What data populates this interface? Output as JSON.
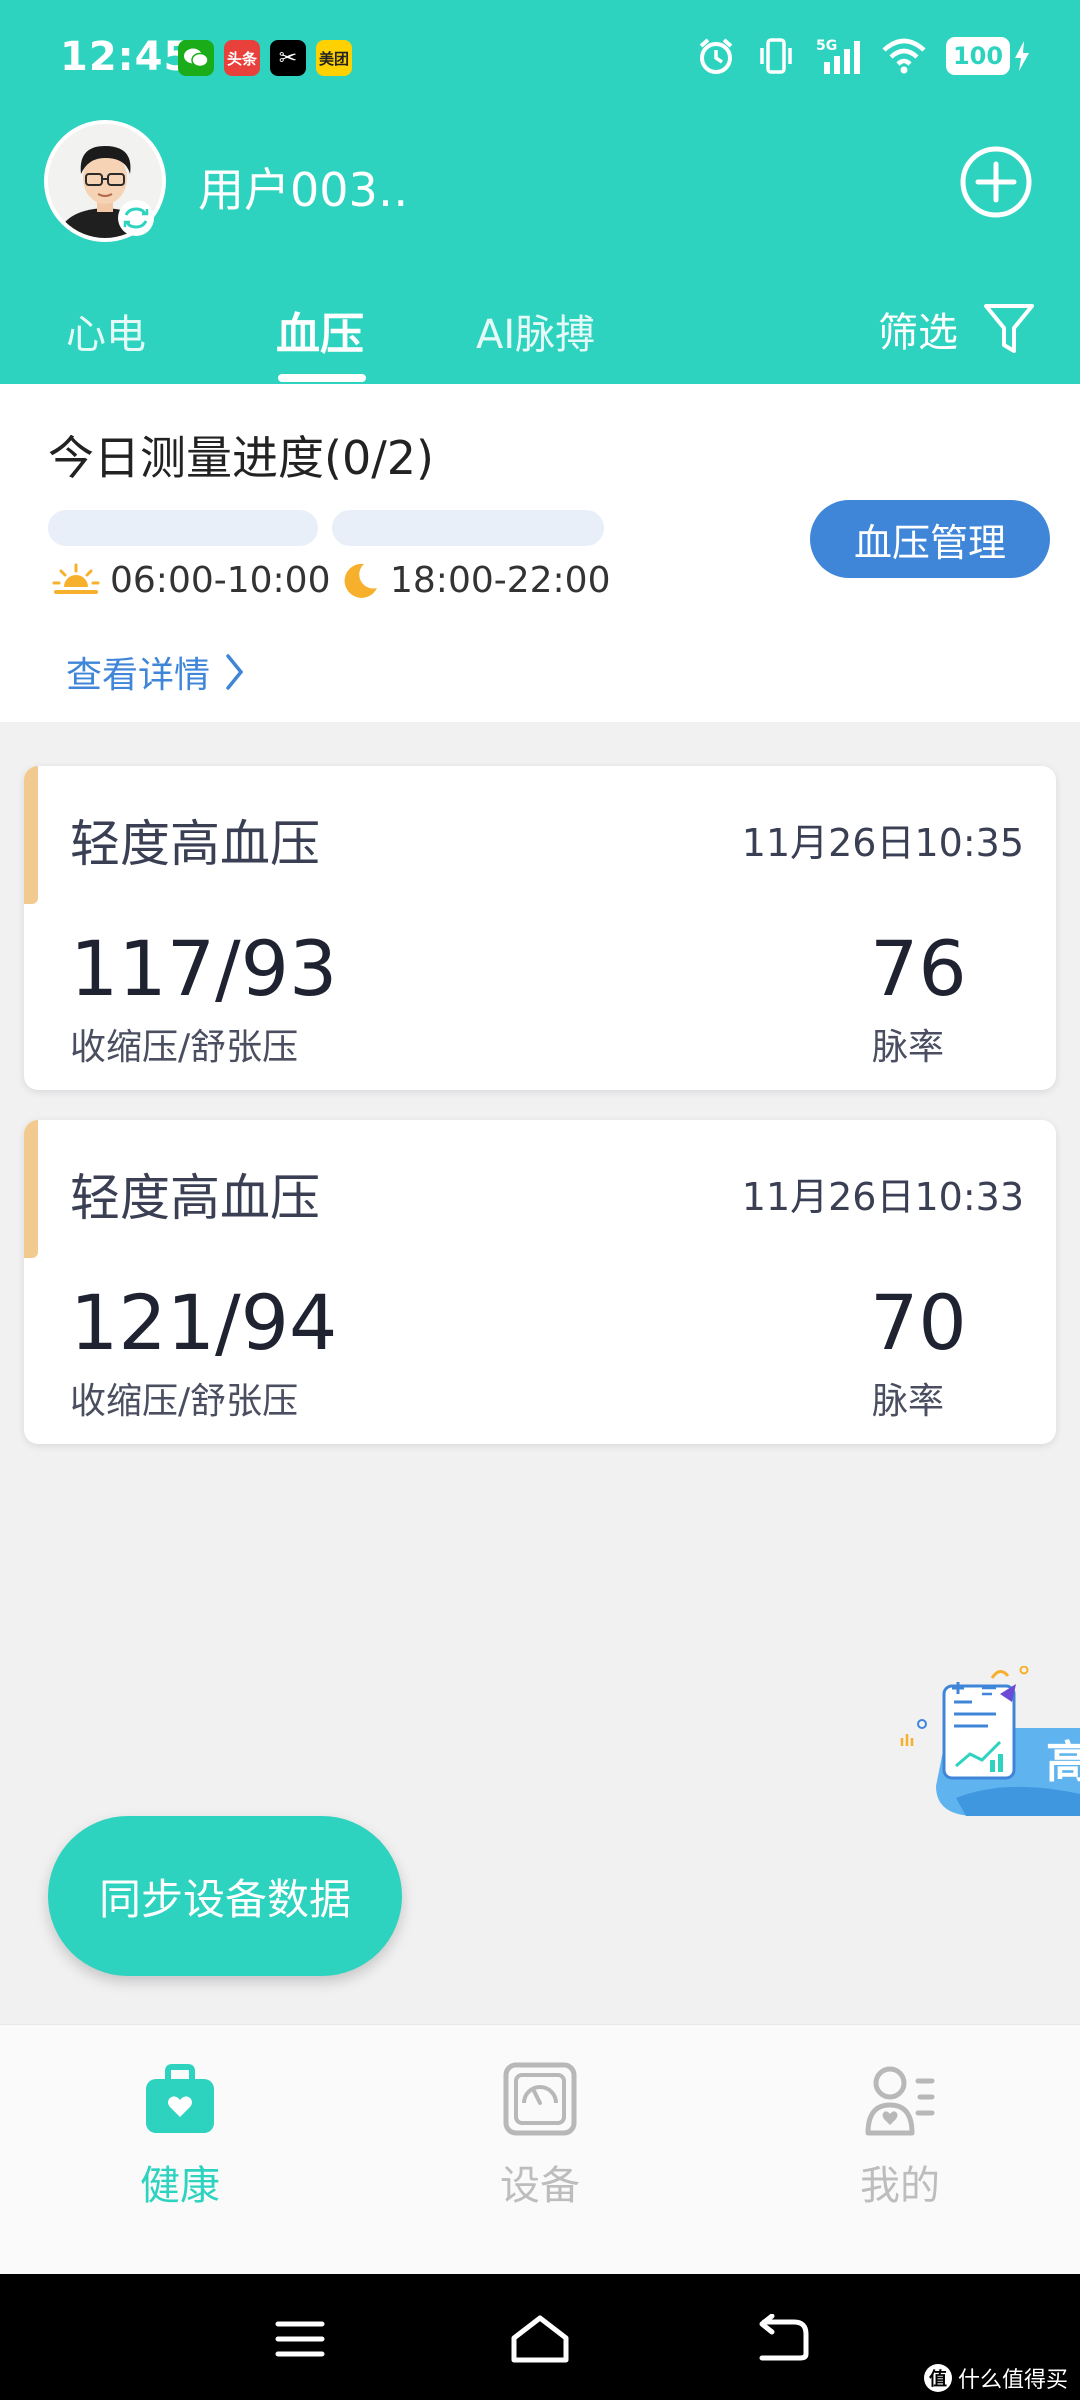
{
  "status_bar": {
    "time": "12:45",
    "apps": [
      {
        "name": "wechat-icon",
        "text": "",
        "bg": "#1aad19",
        "fg": "#ffffff"
      },
      {
        "name": "toutiao-icon",
        "text": "头条",
        "bg": "#e8413b",
        "fg": "#ffffff"
      },
      {
        "name": "capcut-icon",
        "text": "✂",
        "bg": "#000000",
        "fg": "#ffffff"
      },
      {
        "name": "meituan-icon",
        "text": "美团",
        "bg": "#ffd100",
        "fg": "#222222"
      }
    ],
    "network": "5G",
    "battery": "100"
  },
  "header": {
    "username": "用户003‥",
    "tabs": [
      {
        "label": "心电"
      },
      {
        "label": "血压"
      },
      {
        "label": "AI脉搏"
      }
    ],
    "filter_label": "筛选"
  },
  "progress": {
    "title": "今日测量进度(0/2)",
    "slot1": "06:00-10:00",
    "slot2": "18:00-22:00",
    "detail_link": "查看详情",
    "manage_button": "血压管理"
  },
  "records": [
    {
      "level": "轻度高血压",
      "datetime": "11月26日10:35",
      "bp": "117/93",
      "bp_label": "收缩压/舒张压",
      "pulse": "76",
      "pulse_label": "脉率"
    },
    {
      "level": "轻度高血压",
      "datetime": "11月26日10:33",
      "bp": "121/94",
      "bp_label": "收缩压/舒张压",
      "pulse": "70",
      "pulse_label": "脉率"
    }
  ],
  "float_banner": {
    "text": "高"
  },
  "sync_button": "同步设备数据",
  "bottom_nav": [
    {
      "label": "健康",
      "icon": "health-kit-icon",
      "active": true
    },
    {
      "label": "设备",
      "icon": "device-gauge-icon",
      "active": false
    },
    {
      "label": "我的",
      "icon": "profile-icon",
      "active": false
    }
  ],
  "watermark": {
    "badge": "值",
    "text": "什么值得买"
  },
  "colors": {
    "accent": "#2ed3bf",
    "link": "#3f86d9",
    "warning_flag": "#f2c98e"
  }
}
